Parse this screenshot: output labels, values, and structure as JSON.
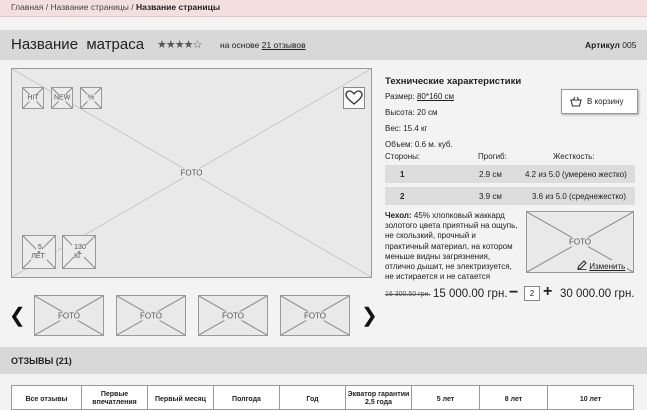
{
  "breadcrumb": {
    "home": "Главная",
    "sep1": "/",
    "page": "Название страницы",
    "sep2": "/",
    "current": "Название страницы"
  },
  "product": {
    "title": "Название  матраса",
    "stars": "★★★★☆",
    "reviews_prefix": "на основе",
    "reviews_link": "21 отзывов",
    "sku_label": "Артикул",
    "sku_value": "005"
  },
  "gallery": {
    "main_label": "FOTO",
    "badges": {
      "hit": "HIT",
      "new": "NEW",
      "percent": "%"
    },
    "bottom_badges": {
      "years": "5\nЛЕТ",
      "weight": "130\nКГ"
    },
    "thumbs": [
      "FOTO",
      "FOTO",
      "FOTO",
      "FOTO"
    ],
    "prev": "❮",
    "next": "❯"
  },
  "specs": {
    "heading": "Технические характеристики",
    "size_label": "Размер:",
    "size_value": "80*160 см",
    "height": "Высота: 20 см",
    "weight": "Вес: 15.4 кг",
    "volume": "Объем: 0.6 м. куб.",
    "col_sides": "Стороны:",
    "col_sag": "Прогиб:",
    "col_stiff": "Жесткость:",
    "rows": [
      {
        "side": "1",
        "sag": "2.9 см",
        "stiff": "4.2 из 5.0 (умерено жестко)"
      },
      {
        "side": "2",
        "sag": "3.9 см",
        "stiff": "3.6 из 5.0 (среднежестко)"
      }
    ]
  },
  "cart_button": "В корзину",
  "cover": {
    "label": "Чехол:",
    "text": "45% хлопковый жаккард золотого цвета приятный на ощупь, не скользкий, прочный и практичный материал, на котором меньше видны загрязнения, отлично дышит, не электризуется, не истирается и не сатается",
    "foto": "FOTO",
    "edit": "Изменить"
  },
  "price": {
    "old": "16 300.50 грн.",
    "current": "15 000.00 грн.",
    "minus": "−",
    "qty": "2",
    "plus": "+",
    "total": "30 000.00 грн."
  },
  "reviews": {
    "heading": "ОТЗЫВЫ (21)",
    "tabs": [
      "Все отзывы",
      "Первые впечатления",
      "Первый месяц",
      "Полгода",
      "Год",
      "Экватор гарантии 2,5 года",
      "5 лет",
      "8 лет",
      "10 лет"
    ]
  }
}
